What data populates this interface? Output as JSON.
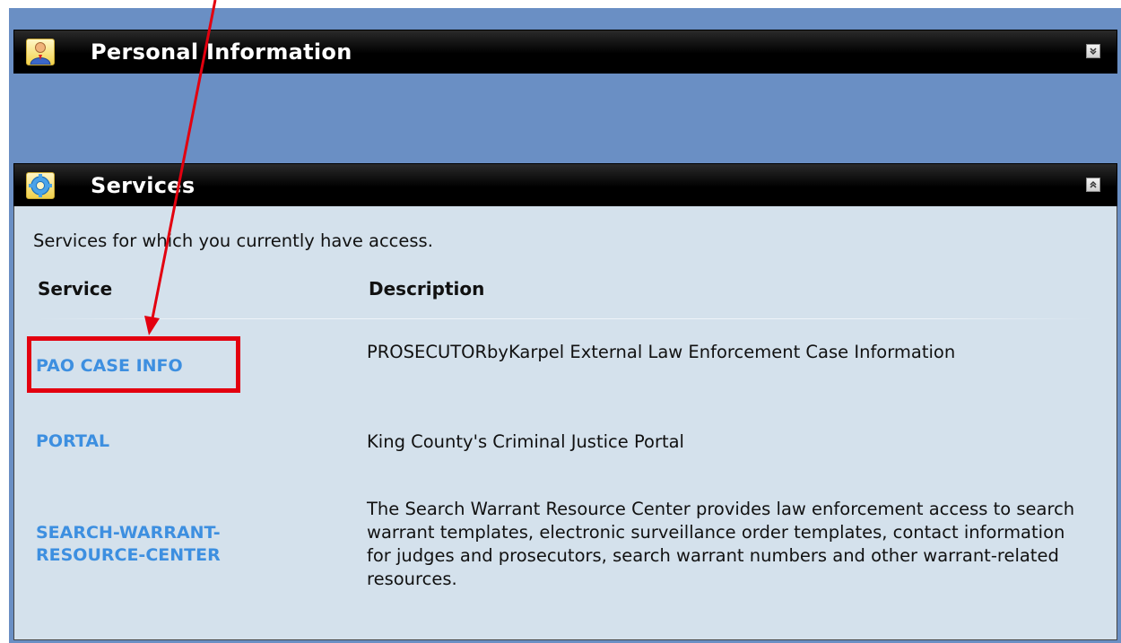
{
  "personal_info": {
    "title": "Personal Information",
    "toggle_glyph": "»",
    "icon": "person-icon"
  },
  "services": {
    "title": "Services",
    "toggle_glyph": "«",
    "icon": "gear-icon",
    "intro": "Services for which you currently have access.",
    "columns": [
      "Service",
      "Description"
    ],
    "rows": [
      {
        "service": "PAO CASE INFO",
        "description": "PROSECUTORbyKarpel External Law Enforcement Case Information"
      },
      {
        "service": "PORTAL",
        "description": "King County's Criminal Justice Portal"
      },
      {
        "service": "SEARCH-WARRANT-RESOURCE-CENTER",
        "description": "The Search Warrant Resource Center provides law enforcement access to search warrant templates, electronic surveillance order templates, contact information for judges and prosecutors, search warrant numbers and other warrant-related resources."
      }
    ]
  },
  "colors": {
    "frame_bg": "#6a8fc4",
    "panel_body": "#d4e1ec",
    "link": "#3d8fe0",
    "annotation": "#e3000f"
  }
}
